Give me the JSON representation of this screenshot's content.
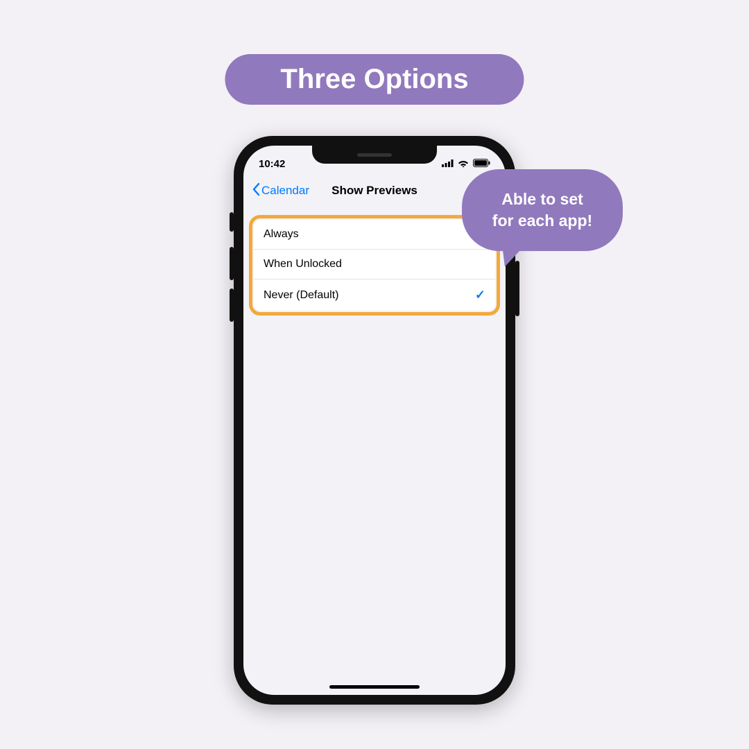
{
  "title": "Three Options",
  "bubble": "Able to set\nfor each app!",
  "statusbar": {
    "time": "10:42"
  },
  "navbar": {
    "back": "Calendar",
    "title": "Show Previews"
  },
  "options": [
    {
      "label": "Always",
      "selected": false
    },
    {
      "label": "When Unlocked",
      "selected": false
    },
    {
      "label": "Never (Default)",
      "selected": true
    }
  ],
  "colors": {
    "accent": "#9179bd",
    "highlight": "#f2a93b",
    "link": "#007aff"
  }
}
